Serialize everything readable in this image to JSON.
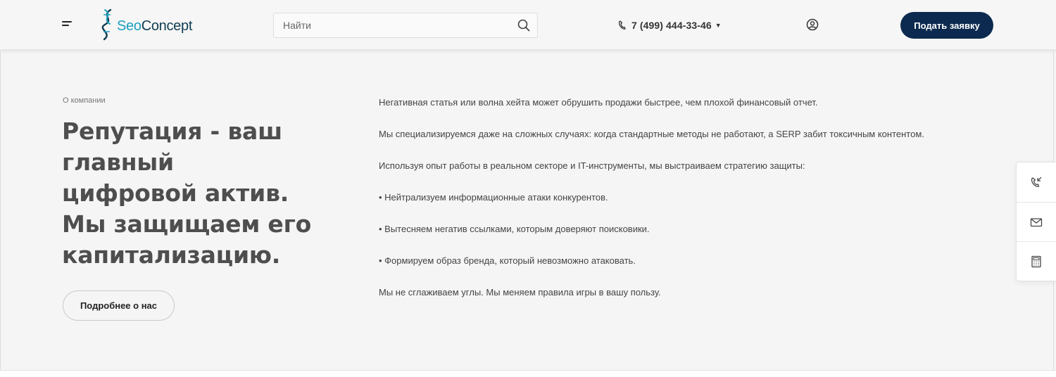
{
  "header": {
    "logo": {
      "part1": "Seo",
      "part2": "Concept",
      "color_primary": "#0e3c52",
      "color_accent": "#1d9fbf"
    },
    "search": {
      "placeholder": "Найти",
      "value": ""
    },
    "phone": {
      "number": "7 (499) 444-33-46"
    },
    "cta_label": "Подать заявку",
    "cta_color": "#0c2a4f",
    "icons": [
      "menu-icon",
      "search-icon",
      "phone-icon",
      "chevron-down-icon",
      "user-icon"
    ]
  },
  "main": {
    "eyebrow": "О компании",
    "headline": "Репутация - ваш главный цифровой актив. Мы защищаем его капитализацию.",
    "more_button": "Подробнее о нас",
    "paragraphs": [
      "Негативная статья или волна хейта может обрушить продажи быстрее, чем плохой финансовый отчет.",
      "Мы специализируемся даже на сложных случаях: когда стандартные методы не работают, а SERP забит токсичным контентом.",
      "Используя опыт работы в реальном секторе и IT-инструменты, мы выстраиваем стратегию защиты:",
      "• Нейтрализуем информационные атаки конкурентов.",
      "• Вытесняем негатив ссылками, которым доверяют поисковики.",
      "• Формируем образ бренда, который невозможно атаковать.",
      "Мы не сглаживаем углы. Мы меняем правила игры в вашу пользу."
    ]
  },
  "side_panel": {
    "items": [
      "callback-icon",
      "mail-icon",
      "calculator-icon"
    ]
  }
}
